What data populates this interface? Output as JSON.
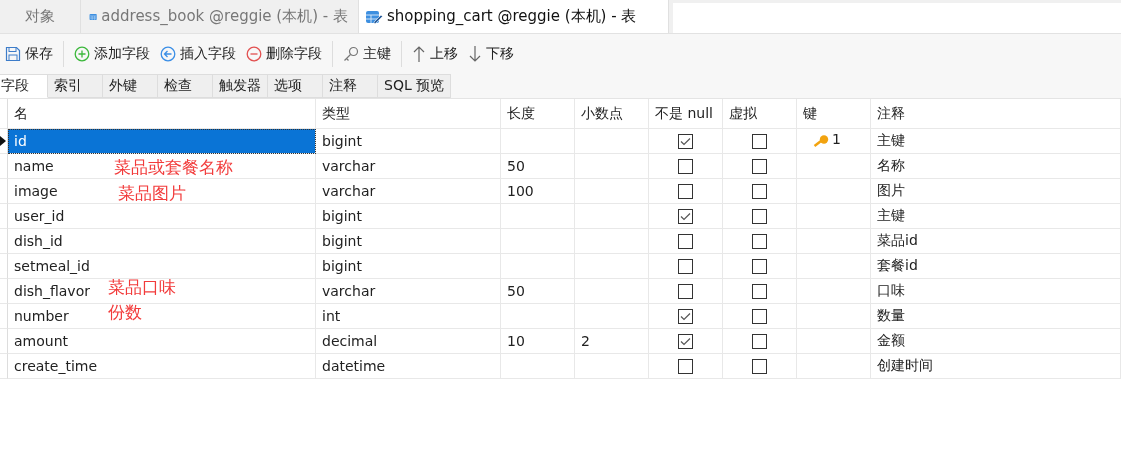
{
  "tabs": [
    {
      "label": "对象",
      "kind": "objects",
      "selected": false
    },
    {
      "label": "address_book @reggie (本机) - 表",
      "kind": "table",
      "selected": false
    },
    {
      "label": "shopping_cart @reggie (本机) - 表",
      "kind": "design",
      "selected": true
    }
  ],
  "toolbar": [
    {
      "label": "保存",
      "kind": "save"
    },
    {
      "label": "添加字段",
      "kind": "add"
    },
    {
      "label": "插入字段",
      "kind": "insert"
    },
    {
      "label": "删除字段",
      "kind": "delete"
    },
    {
      "label": "主键",
      "kind": "key"
    },
    {
      "label": "上移",
      "kind": "up"
    },
    {
      "label": "下移",
      "kind": "down"
    }
  ],
  "sub_tabs": [
    {
      "label": "字段",
      "selected": true
    },
    {
      "label": "索引",
      "selected": false
    },
    {
      "label": "外键",
      "selected": false
    },
    {
      "label": "检查",
      "selected": false
    },
    {
      "label": "触发器",
      "selected": false
    },
    {
      "label": "选项",
      "selected": false
    },
    {
      "label": "注释",
      "selected": false
    },
    {
      "label": "SQL 预览",
      "selected": false
    }
  ],
  "table": {
    "columns": [
      "名",
      "类型",
      "长度",
      "小数点",
      "不是 null",
      "虚拟",
      "键",
      "注释"
    ],
    "rows": [
      {
        "name": "id",
        "type": "bigint",
        "length": "",
        "decimals": "",
        "not_null": true,
        "virtual": false,
        "key": "1",
        "comment": "主键",
        "selected": true
      },
      {
        "name": "name",
        "annotation": "菜品或套餐名称",
        "type": "varchar",
        "length": "50",
        "decimals": "",
        "not_null": false,
        "virtual": false,
        "key": "",
        "comment": "名称",
        "selected": false
      },
      {
        "name": "image",
        "annotation": "菜品图片",
        "type": "varchar",
        "length": "100",
        "decimals": "",
        "not_null": false,
        "virtual": false,
        "key": "",
        "comment": "图片",
        "selected": false
      },
      {
        "name": "user_id",
        "type": "bigint",
        "length": "",
        "decimals": "",
        "not_null": true,
        "virtual": false,
        "key": "",
        "comment": "主键",
        "selected": false
      },
      {
        "name": "dish_id",
        "type": "bigint",
        "length": "",
        "decimals": "",
        "not_null": false,
        "virtual": false,
        "key": "",
        "comment": "菜品id",
        "selected": false
      },
      {
        "name": "setmeal_id",
        "type": "bigint",
        "length": "",
        "decimals": "",
        "not_null": false,
        "virtual": false,
        "key": "",
        "comment": "套餐id",
        "selected": false
      },
      {
        "name": "dish_flavor",
        "annotation": "菜品口味",
        "type": "varchar",
        "length": "50",
        "decimals": "",
        "not_null": false,
        "virtual": false,
        "key": "",
        "comment": "口味",
        "selected": false
      },
      {
        "name": "number",
        "annotation": "份数",
        "type": "int",
        "length": "",
        "decimals": "",
        "not_null": true,
        "virtual": false,
        "key": "",
        "comment": "数量",
        "selected": false
      },
      {
        "name": "amount",
        "type": "decimal",
        "length": "10",
        "decimals": "2",
        "not_null": true,
        "virtual": false,
        "key": "",
        "comment": "金额",
        "selected": false
      },
      {
        "name": "create_time",
        "type": "datetime",
        "length": "",
        "decimals": "",
        "not_null": false,
        "virtual": false,
        "key": "",
        "comment": "创建时间",
        "selected": false
      }
    ]
  }
}
